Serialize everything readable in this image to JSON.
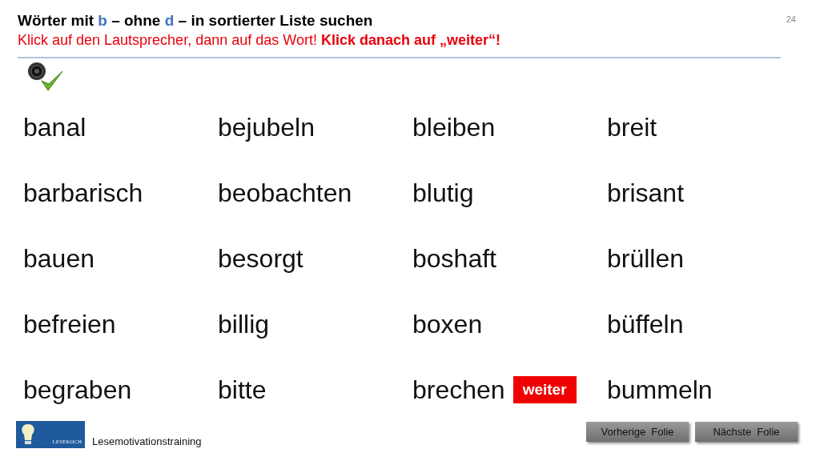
{
  "title": [
    {
      "text": "Wörter mit ",
      "color": "#000000"
    },
    {
      "text": "b",
      "color": "#4472c4"
    },
    {
      "text": " – ohne ",
      "color": "#000000"
    },
    {
      "text": "d",
      "color": "#4472c4"
    },
    {
      "text": " – in sortierter Liste suchen",
      "color": "#000000"
    }
  ],
  "instruction": "Klick auf den Lautsprecher, dann auf das Wort! **Klick danach auf „weiter“!**",
  "page_number": "24",
  "speaker": {
    "checked": true
  },
  "words": [
    {
      "text": "banal"
    },
    {
      "text": "bejubeln"
    },
    {
      "text": "bleiben"
    },
    {
      "text": "breit"
    },
    {
      "text": "barbarisch"
    },
    {
      "text": "beobachten"
    },
    {
      "text": "blutig"
    },
    {
      "text": "brisant"
    },
    {
      "text": "bauen"
    },
    {
      "text": "besorgt"
    },
    {
      "text": "boshaft"
    },
    {
      "text": "brüllen"
    },
    {
      "text": "befreien"
    },
    {
      "text": "billig"
    },
    {
      "text": "boxen"
    },
    {
      "text": "büffeln"
    },
    {
      "text": "begraben"
    },
    {
      "text": "bitte"
    },
    {
      "text": "brechen",
      "button": "weiter"
    },
    {
      "text": "bummeln"
    }
  ],
  "footer": {
    "logo_text": "LESEKOCH",
    "caption": "Lesemotivationstraining",
    "buttons": [
      "Vorherige  Folie",
      "Nächste  Folie"
    ]
  }
}
